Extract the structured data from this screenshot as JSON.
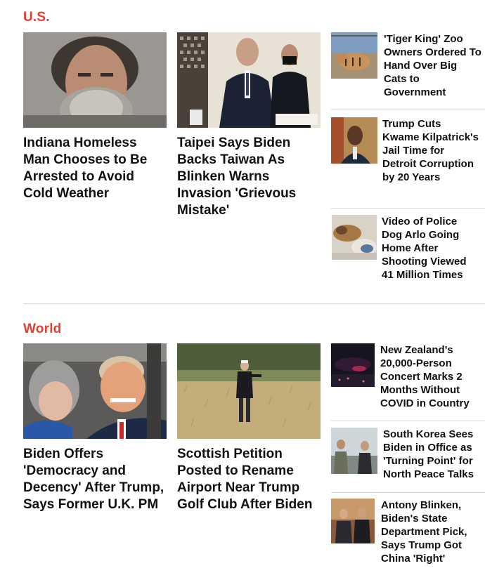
{
  "sections": [
    {
      "title": "U.S.",
      "main": [
        {
          "headline": "Indiana Homeless Man Chooses to Be Arrested to Avoid Cold Weather"
        },
        {
          "headline": "Taipei Says Biden Backs Taiwan As Blinken Warns Invasion 'Grievous Mistake'"
        }
      ],
      "side": [
        {
          "headline": "'Tiger King' Zoo Owners Ordered To Hand Over Big Cats to Government"
        },
        {
          "headline": "Trump Cuts Kwame Kilpatrick's Jail Time for Detroit Corruption by 20 Years"
        },
        {
          "headline": "Video of Police Dog Arlo Going Home After Shooting Viewed 41 Million Times"
        }
      ]
    },
    {
      "title": "World",
      "main": [
        {
          "headline": "Biden Offers 'Democracy and Decency' After Trump, Says Former U.K. PM"
        },
        {
          "headline": "Scottish Petition Posted to Rename Airport Near Trump Golf Club After Biden"
        }
      ],
      "side": [
        {
          "headline": "New Zealand's 20,000-Person Concert Marks 2 Months Without COVID in Country"
        },
        {
          "headline": "South Korea Sees Biden in Office as 'Turning Point' for North Peace Talks"
        },
        {
          "headline": "Antony Blinken, Biden's State Department Pick, Says Trump Got China 'Right'"
        }
      ]
    }
  ],
  "colors": {
    "section_title": "#e5402e",
    "headline": "#111111",
    "divider": "#d9d9d9"
  }
}
